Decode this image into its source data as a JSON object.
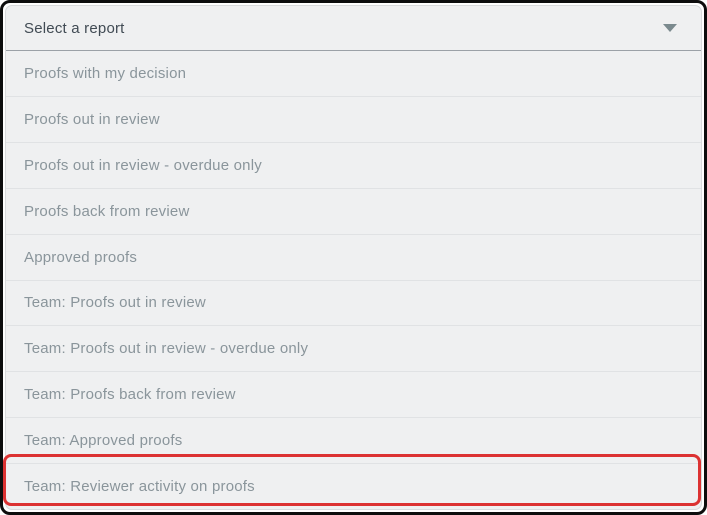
{
  "dropdown": {
    "header_label": "Select a report",
    "items": [
      "Proofs with my decision",
      "Proofs out in review",
      "Proofs out in review - overdue only",
      "Proofs back from review",
      "Approved proofs",
      "Team: Proofs out in review",
      "Team: Proofs out in review - overdue only",
      "Team: Proofs back from review",
      "Team: Approved proofs",
      "Team: Reviewer activity on proofs"
    ]
  },
  "annotation": {
    "type": "highlight-box",
    "target": "Team: Reviewer activity on proofs",
    "highlighted_index": 9,
    "color": "#dc3232"
  },
  "colors": {
    "panel_background": "#eff0f1",
    "header_text": "#414b54",
    "item_text": "#8a959b",
    "header_divider": "#9ba1a7",
    "item_divider": "#e0e2e4",
    "frame": "#0d0d0d",
    "chevron": "#7b8a8e",
    "highlight_border": "#dc3232"
  }
}
